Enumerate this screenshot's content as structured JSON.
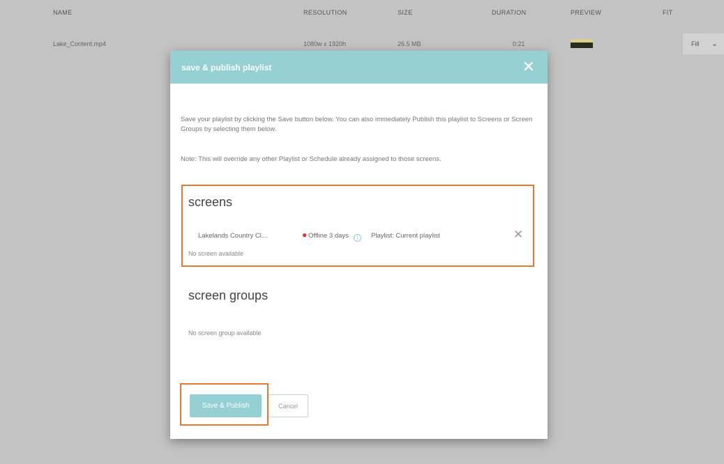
{
  "table": {
    "headers": [
      "NAME",
      "RESOLUTION",
      "SIZE",
      "DURATION",
      "PREVIEW",
      "FIT"
    ],
    "row": {
      "name": "Lake_Content.mp4",
      "resolution": "1080w x 1920h",
      "size": "26.5 MB",
      "duration": "0:21",
      "fit": "Fill"
    }
  },
  "modal": {
    "title": "save & publish playlist",
    "close_icon": "close-icon",
    "intro": "Save your playlist by clicking the Save button below. You can also immediately Publish this playlist to Screens or Screen Groups by selecting them below.",
    "note": "Note: This will override any other Playlist or Schedule already assigned to those screens.",
    "screens": {
      "title": "screens",
      "items": [
        {
          "name": "Lakelands Country Cl...",
          "status": "Offline 3 days",
          "playlist": "Playlist: Current playlist"
        }
      ],
      "empty_text": "No screen available"
    },
    "screen_groups": {
      "title": "screen groups",
      "empty_text": "No screen group available"
    },
    "buttons": {
      "primary": "Save & Publish",
      "cancel": "Cancel"
    }
  },
  "colors": {
    "accent": "#94d0d4",
    "highlight": "#e8792c",
    "offline": "#d33333"
  }
}
